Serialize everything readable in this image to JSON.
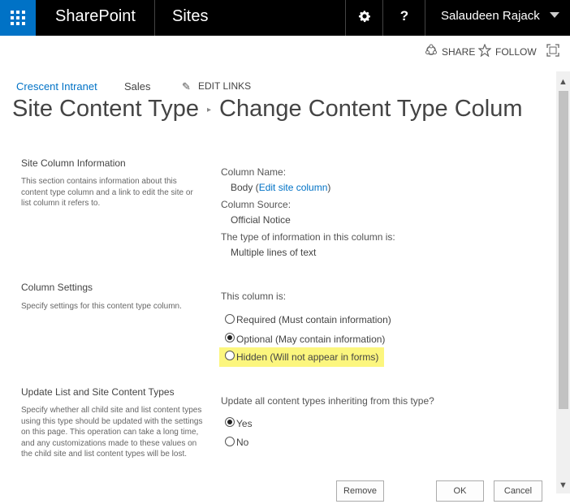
{
  "suitebar": {
    "app_name": "SharePoint",
    "sites_label": "Sites",
    "settings_icon": "gear-icon",
    "help_label": "?",
    "user_name": "Salaudeen Rajack"
  },
  "actions": {
    "share_label": "SHARE",
    "follow_label": "FOLLOW"
  },
  "nav": {
    "site_name": "Crescent Intranet",
    "sales_label": "Sales",
    "edit_links_label": "EDIT LINKS"
  },
  "title": {
    "part1": "Site Content Type",
    "separator": "▸",
    "part2": "Change Content Type Colum"
  },
  "section1": {
    "title": "Site Column Information",
    "description": "This section contains information about this content type column and a link to edit the site or list column it refers to.",
    "column_name_label": "Column Name:",
    "column_name_value": "Body (",
    "edit_link": "Edit site column",
    "column_name_close": ")",
    "column_source_label": "Column Source:",
    "column_source_value": "Official Notice",
    "type_label": "The type of information in this column is:",
    "type_value": "Multiple lines of text"
  },
  "section2": {
    "title": "Column Settings",
    "description": "Specify settings for this content type column.",
    "prompt": "This column is:",
    "options": [
      {
        "label": "Required (Must contain information)",
        "selected": false
      },
      {
        "label": "Optional (May contain information)",
        "selected": true
      },
      {
        "label": "Hidden (Will not appear in forms)",
        "selected": false
      }
    ],
    "highlight_color": "#fcf67e"
  },
  "section3": {
    "title": "Update List and Site Content Types",
    "description": "Specify whether all child site and list content types using this type should be updated with the settings on this page. This operation can take a long time, and any customizations made to these values on the child site and list content types will be lost.",
    "prompt": "Update all content types inheriting from this type?",
    "options": [
      {
        "label": "Yes",
        "selected": true
      },
      {
        "label": "No",
        "selected": false
      }
    ]
  },
  "buttons": {
    "remove": "Remove",
    "ok": "OK",
    "cancel": "Cancel"
  },
  "colors": {
    "suitebar_bg": "#000000",
    "waffle_bg": "#0072c6",
    "link": "#0072c6"
  }
}
